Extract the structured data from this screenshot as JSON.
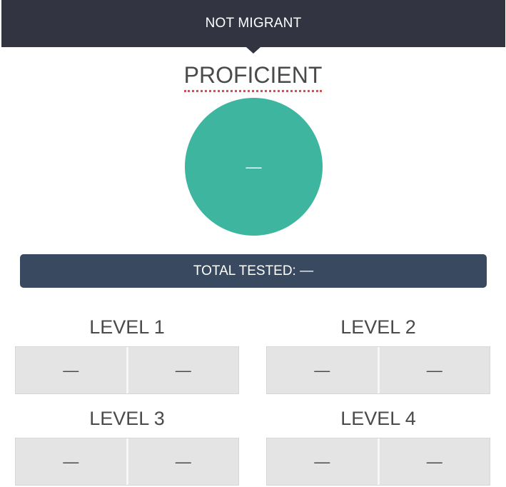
{
  "header": {
    "title": "NOT MIGRANT"
  },
  "proficient": {
    "title": "PROFICIENT",
    "value": "—"
  },
  "total_tested": {
    "label": "TOTAL TESTED:",
    "value": "—"
  },
  "levels": [
    {
      "title": "LEVEL 1",
      "values": [
        "—",
        "—"
      ]
    },
    {
      "title": "LEVEL 2",
      "values": [
        "—",
        "—"
      ]
    },
    {
      "title": "LEVEL 3",
      "values": [
        "—",
        "—"
      ]
    },
    {
      "title": "LEVEL 4",
      "values": [
        "—",
        "—"
      ]
    }
  ],
  "colors": {
    "header_bg": "#323541",
    "proficient_circle": "#3eb59f",
    "total_bar_bg": "#39495f",
    "level_box_bg": "#e4e4e4",
    "spellcheck_underline": "#c9545c"
  }
}
